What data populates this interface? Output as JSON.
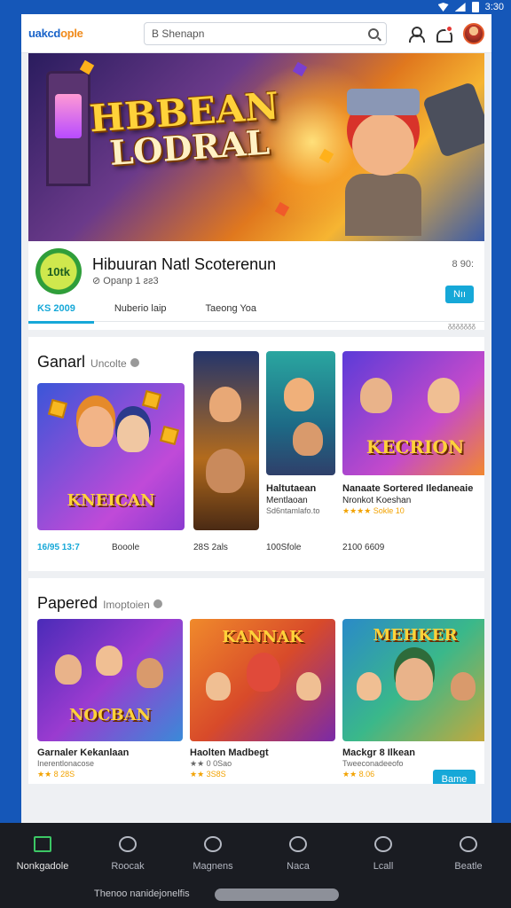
{
  "status_bar": {
    "time": "3:30"
  },
  "header": {
    "logo_main": "uakcd",
    "logo_accent": "ople",
    "search_placeholder": "B Shenapn"
  },
  "hero": {
    "title_line1": "HBBEAN",
    "title_line2": "LODRAL"
  },
  "game": {
    "logo_text": "10tk",
    "name": "Hibuuran Natl Scoterenun",
    "meta": "⊘ Opanp 1 ƨƨ3",
    "rating": "8 90:",
    "follow_label": "Nıı",
    "tabs": [
      {
        "label": "ƘS 2009"
      },
      {
        "label": "Nuberio laip"
      },
      {
        "label": "Taeong Yoa"
      }
    ],
    "tab_count": "ᵹᵹᵹᵹᵹᵹᵹ"
  },
  "games_section": {
    "title": "Ganarl",
    "subtitle": "Uncolte",
    "tiles": [
      {
        "art_text": "KNEICAN",
        "price": "16/95 13:7"
      },
      {
        "art_text": "",
        "price": "Booole"
      },
      {
        "art_text": "",
        "price": "28S 2als"
      },
      {
        "art_text": "",
        "price": "100Sfole"
      },
      {
        "art_text": "KECRION",
        "price": "2100 6609"
      }
    ],
    "captions": [
      {
        "title": "Haltutaean",
        "subtitle": "Mentlaoan",
        "extra": "Sd6ntamlafo.to"
      },
      {
        "title": "Nanaate Sortered Iledaneaie",
        "subtitle": "Nronkot Koeshan",
        "extra": "★★★★ Sokle 10"
      }
    ]
  },
  "popular_section": {
    "title": "Papered",
    "subtitle": "Imoptoien",
    "tiles": [
      {
        "art_text": "NOCBAN",
        "title": "Garnaler Kekanlaan",
        "subtitle": "Inerentlonacose",
        "rating": "★★ 8 28S"
      },
      {
        "art_text": "KANNAK",
        "title": "Haolten Madbegt",
        "subtitle": "★★ 0 0Sao",
        "rating": "★★ 3S8S"
      },
      {
        "art_text": "MEHKER",
        "title": "Mackgr 8 Ilkean",
        "subtitle": "Tweeconadeeofo",
        "rating": "★★ 8.06"
      }
    ],
    "play_label": "Bame"
  },
  "bottom_nav": {
    "items": [
      {
        "label": "Nonkgadole",
        "icon": "home-icon"
      },
      {
        "label": "Roocak",
        "icon": "chef-hat-icon"
      },
      {
        "label": "Magnens",
        "icon": "puzzle-icon"
      },
      {
        "label": "Naca",
        "icon": "chat-icon"
      },
      {
        "label": "Lcall",
        "icon": "compass-icon"
      },
      {
        "label": "Beatle",
        "icon": "search-icon"
      }
    ],
    "footer_text": "Thenoo nanidejonelfis"
  },
  "colors": {
    "accent": "#16a8d8",
    "brand_blue": "#1557b8",
    "nav_active": "#3cc765",
    "nav_bg": "#1a1c22"
  }
}
